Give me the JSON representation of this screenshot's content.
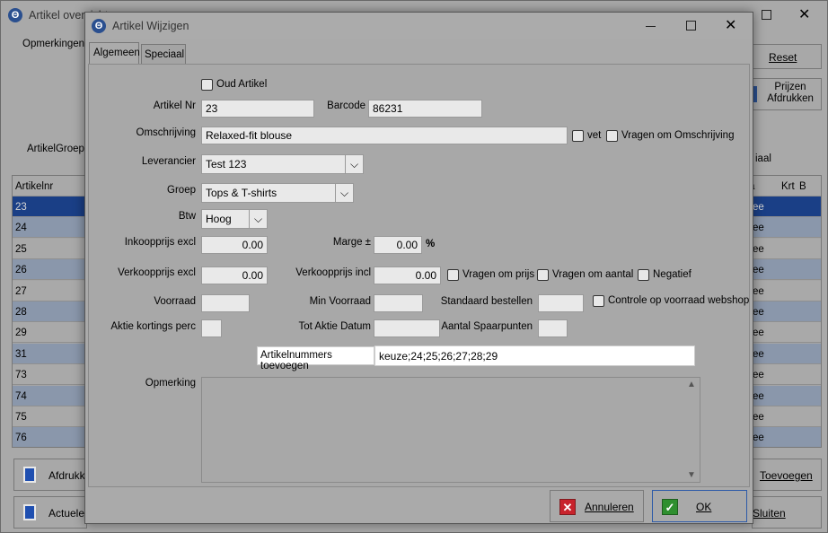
{
  "bg": {
    "title": "Artikel overzicht",
    "opmerkingen": "Opmerkingen",
    "artikelgroep": "ArtikelGroep",
    "reset": "Reset",
    "prijzen": "Prijzen Afdrukken",
    "speciaal_tab": "iaal",
    "col_artikelnr": "Artikelnr",
    "col_a": "a",
    "col_krt": "Krt",
    "col_b": "B",
    "rows": [
      "23",
      "24",
      "25",
      "26",
      "27",
      "28",
      "29",
      "31",
      "73",
      "74",
      "75",
      "76"
    ],
    "row_suffix": "ee",
    "afdrukken": "Afdrukke",
    "actuele": "Actuele",
    "toevoegen": "Toevoegen",
    "sluiten": "Sluiten"
  },
  "dialog": {
    "title": "Artikel Wijzigen",
    "tabs": [
      "Algemeen",
      "Speciaal"
    ],
    "oud_artikel": "Oud Artikel",
    "artikel_nr_label": "Artikel Nr",
    "artikel_nr": "23",
    "barcode_label": "Barcode",
    "barcode": "86231",
    "omschrijving_label": "Omschrijving",
    "omschrijving": "Relaxed-fit blouse",
    "vet": "vet",
    "vragen_omschrijving": "Vragen om Omschrijving",
    "leverancier_label": "Leverancier",
    "leverancier": "Test 123",
    "groep_label": "Groep",
    "groep": "Tops & T-shirts",
    "btw_label": "Btw",
    "btw": "Hoog",
    "inkoopprijs_label": "Inkoopprijs excl",
    "inkoopprijs": "0.00",
    "marge_label": "Marge ±",
    "marge": "0.00",
    "percent": "%",
    "verkoopprijs_excl_label": "Verkoopprijs excl",
    "verkoopprijs_excl": "0.00",
    "verkoopprijs_incl_label": "Verkoopprijs incl",
    "verkoopprijs_incl": "0.00",
    "vragen_prijs": "Vragen om prijs",
    "vragen_aantal": "Vragen om aantal",
    "negatief": "Negatief",
    "voorraad_label": "Voorraad",
    "min_voorraad_label": "Min Voorraad",
    "standaard_bestellen_label": "Standaard bestellen",
    "controle_voorraad": "Controle op voorraad webshop",
    "aktie_kortings_label": "Aktie kortings perc",
    "tot_aktie_label": "Tot Aktie Datum",
    "aantal_spaarpunten_label": "Aantal Spaarpunten",
    "artikelnummers_toevoegen": "Artikelnummers toevoegen",
    "artikelnummers_value": "keuze;24;25;26;27;28;29",
    "opmerking_label": "Opmerking",
    "annuleren": "Annuleren",
    "ok": "OK"
  }
}
